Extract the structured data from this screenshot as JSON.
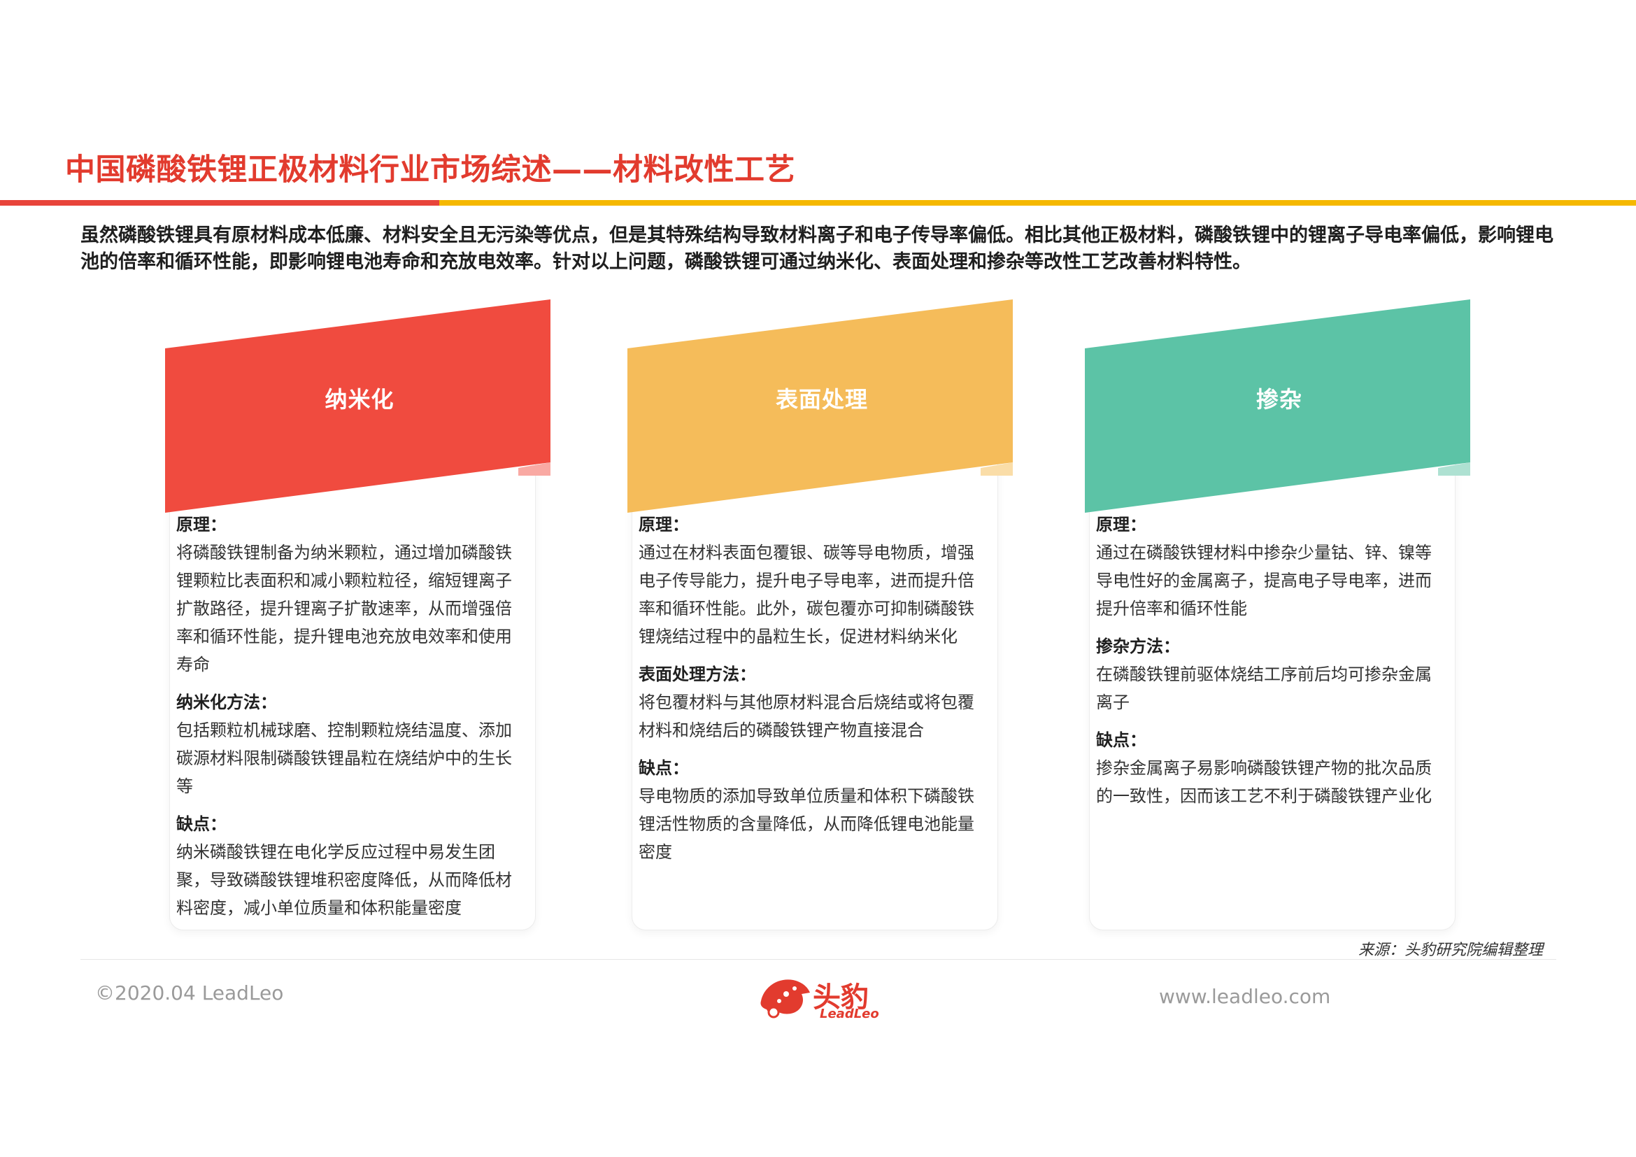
{
  "header": {
    "title": "中国磷酸铁锂正极材料行业市场综述——材料改性工艺"
  },
  "intro": "虽然磷酸铁锂具有原材料成本低廉、材料安全且无污染等优点，但是其特殊结构导致材料离子和电子传导率偏低。相比其他正极材料，磷酸铁锂中的锂离子导电率偏低，影响锂电池的倍率和循环性能，即影响锂电池寿命和充放电效率。针对以上问题，磷酸铁锂可通过纳米化、表面处理和掺杂等改性工艺改善材料特性。",
  "cards": [
    {
      "title": "纳米化",
      "color": "#F04B3F",
      "sections": [
        {
          "label": "原理：",
          "text": "将磷酸铁锂制备为纳米颗粒，通过增加磷酸铁锂颗粒比表面积和减小颗粒粒径，缩短锂离子扩散路径，提升锂离子扩散速率，从而增强倍率和循环性能，提升锂电池充放电效率和使用寿命"
        },
        {
          "label": "纳米化方法：",
          "text": "包括颗粒机械球磨、控制颗粒烧结温度、添加碳源材料限制磷酸铁锂晶粒在烧结炉中的生长等"
        },
        {
          "label": "缺点：",
          "text": "纳米磷酸铁锂在电化学反应过程中易发生团聚，导致磷酸铁锂堆积密度降低，从而降低材料密度，减小单位质量和体积能量密度"
        }
      ]
    },
    {
      "title": "表面处理",
      "color": "#F5BC5A",
      "sections": [
        {
          "label": "原理：",
          "text": "通过在材料表面包覆银、碳等导电物质，增强电子传导能力，提升电子导电率，进而提升倍率和循环性能。此外，碳包覆亦可抑制磷酸铁锂烧结过程中的晶粒生长，促进材料纳米化"
        },
        {
          "label": "表面处理方法：",
          "text": "将包覆材料与其他原材料混合后烧结或将包覆材料和烧结后的磷酸铁锂产物直接混合"
        },
        {
          "label": "缺点：",
          "text": "导电物质的添加导致单位质量和体积下磷酸铁锂活性物质的含量降低，从而降低锂电池能量密度"
        }
      ]
    },
    {
      "title": "掺杂",
      "color": "#5CC3A6",
      "sections": [
        {
          "label": "原理：",
          "text": "通过在磷酸铁锂材料中掺杂少量钴、锌、镍等导电性好的金属离子，提高电子导电率，进而提升倍率和循环性能"
        },
        {
          "label": "掺杂方法：",
          "text": "在磷酸铁锂前驱体烧结工序前后均可掺杂金属离子"
        },
        {
          "label": "缺点：",
          "text": "掺杂金属离子易影响磷酸铁锂产物的批次品质的一致性，因而该工艺不利于磷酸铁锂产业化"
        }
      ]
    }
  ],
  "footer": {
    "source": "来源：头豹研究院编辑整理",
    "copyright": "©2020.04 LeadLeo",
    "website": "www.leadleo.com",
    "logo_cn": "头豹",
    "logo_en": "LeadLeo",
    "brand_color": "#E23B2E"
  }
}
